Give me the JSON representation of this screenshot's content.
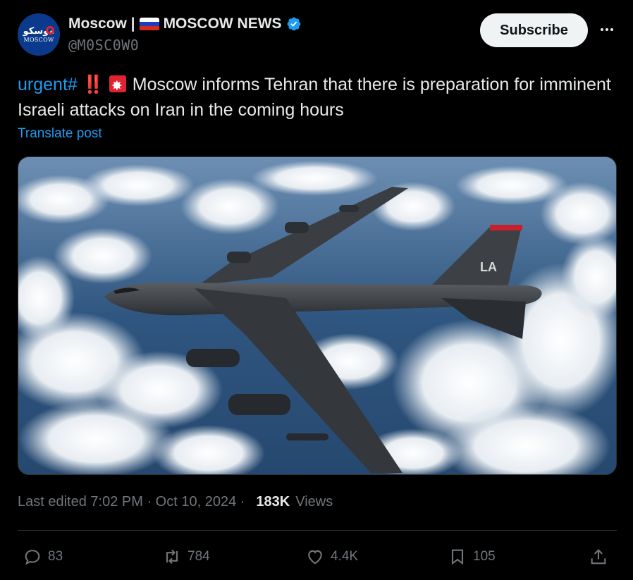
{
  "account": {
    "display_name": "Moscow |",
    "channel_name": "MOSCOW NEWS",
    "handle": "@M0SC0W0",
    "avatar_arabic": "موسكو",
    "avatar_latin": "MOSCOW"
  },
  "subscribe_label": "Subscribe",
  "post": {
    "hashtag": "urgent#",
    "bang": "‼️",
    "text": "Moscow informs Tehran that there is preparation for imminent Israeli attacks on Iran in the coming hours",
    "translate_label": "Translate post",
    "image_tail_text": "LA"
  },
  "meta": {
    "edited": "Last edited 7:02 PM · Oct 10, 2024 ·",
    "views_count": "183K",
    "views_label": "Views"
  },
  "actions": {
    "replies": "83",
    "reposts": "784",
    "likes": "4.4K",
    "bookmarks": "105"
  },
  "colors": {
    "background": "#000000",
    "accent_blue": "#1d9bf0",
    "muted": "#71767b",
    "text": "#e7e9ea",
    "divider": "#2f3336"
  },
  "icons": [
    "verified-badge-icon",
    "russia-flag-icon",
    "more-icon",
    "siren-icon",
    "reply-icon",
    "repost-icon",
    "like-icon",
    "bookmark-icon",
    "share-icon"
  ]
}
